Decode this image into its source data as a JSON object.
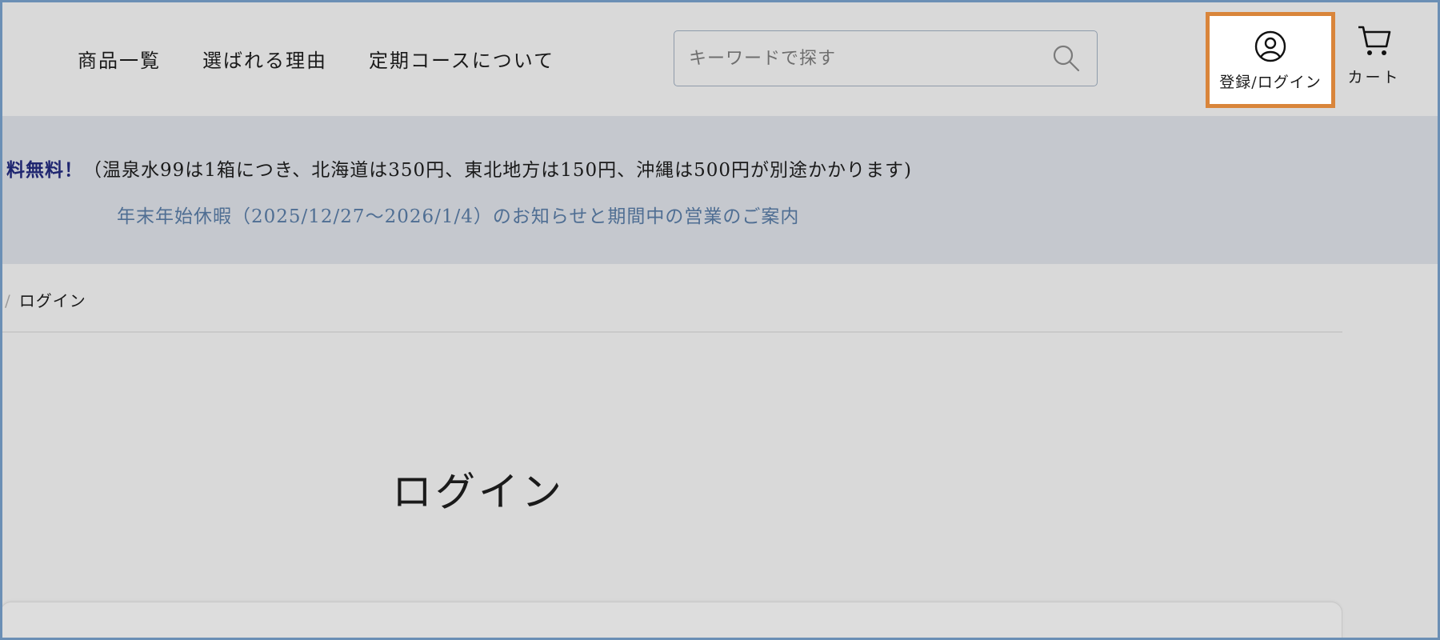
{
  "header": {
    "nav": [
      {
        "label": "商品一覧"
      },
      {
        "label": "選ばれる理由"
      },
      {
        "label": "定期コースについて"
      }
    ],
    "search": {
      "placeholder": "キーワードで探す",
      "value": ""
    },
    "login_label": "登録/ログイン",
    "cart_label": "カート"
  },
  "notice": {
    "shipping_highlight": "料無料！",
    "shipping_text": "（温泉水99は1箱につき、北海道は350円、東北地方は150円、沖縄は500円が別途かかります)",
    "holiday_link": "年末年始休暇（2025/12/27〜2026/1/4）のお知らせと期間中の営業のご案内"
  },
  "breadcrumb": {
    "separator": "/",
    "current": "ログイン"
  },
  "main": {
    "title": "ログイン"
  },
  "colors": {
    "accent_border": "#d9853b",
    "highlight_text": "#1f2670",
    "link": "#4f6e93"
  }
}
